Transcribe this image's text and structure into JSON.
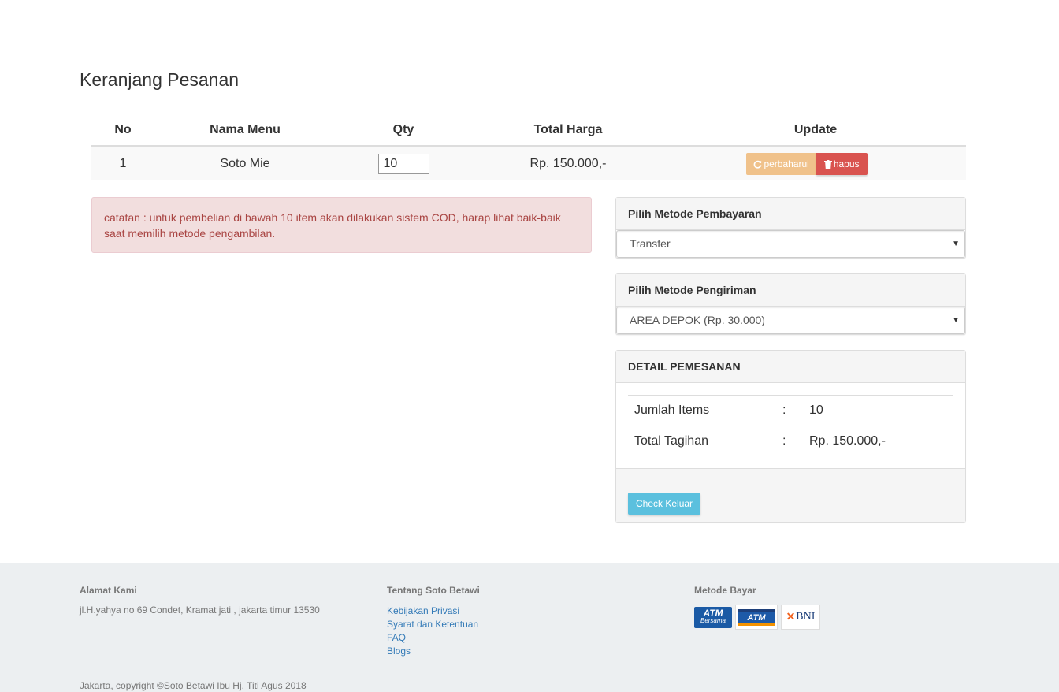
{
  "page_title": "Keranjang Pesanan",
  "cart": {
    "headers": [
      "No",
      "Nama Menu",
      "Qty",
      "Total Harga",
      "Update"
    ],
    "rows": [
      {
        "no": "1",
        "menu": "Soto Mie",
        "qty": "10",
        "total": "Rp. 150.000,-",
        "update_label": "perbaharui",
        "delete_label": "hapus"
      }
    ]
  },
  "alert": {
    "text": "catatan : untuk pembelian di bawah 10 item akan dilakukan sistem COD, harap lihat baik-baik saat memilih metode pengambilan."
  },
  "payment": {
    "heading": "Pilih Metode Pembayaran",
    "selected": "Transfer"
  },
  "shipping": {
    "heading": "Pilih Metode Pengiriman",
    "selected": "AREA DEPOK (Rp. 30.000)"
  },
  "detail": {
    "heading": "DETAIL PEMESANAN",
    "rows": [
      {
        "label": "Jumlah Items",
        "sep": ":",
        "value": "10"
      },
      {
        "label": "Total Tagihan",
        "sep": ":",
        "value": "Rp. 150.000,-"
      }
    ],
    "checkout_label": "Check Keluar"
  },
  "footer": {
    "address": {
      "heading": "Alamat Kami",
      "text": "jl.H.yahya no 69 Condet, Kramat jati , jakarta timur 13530"
    },
    "about": {
      "heading": "Tentang Soto Betawi",
      "links": [
        "Kebijakan Privasi",
        "Syarat dan Ketentuan",
        "FAQ",
        "Blogs"
      ]
    },
    "payment_methods": {
      "heading": "Metode Bayar",
      "logos": [
        {
          "name": "atm-bersama-logo",
          "text": "ATM",
          "subtext": "Bersama"
        },
        {
          "name": "atm-logo",
          "text": "ATM"
        },
        {
          "name": "bni-logo",
          "mark": "✕",
          "text": "BNI"
        }
      ]
    },
    "copyright": "Jakarta, copyright ©Soto Betawi Ibu Hj. Titi Agus 2018"
  },
  "colors": {
    "warning_button": "#f0c28b",
    "danger_button": "#d9534f",
    "info_button": "#5bc0de",
    "alert_bg": "#f2dede",
    "alert_text": "#a94442",
    "footer_bg": "#eceff1",
    "link": "#337ab7"
  }
}
